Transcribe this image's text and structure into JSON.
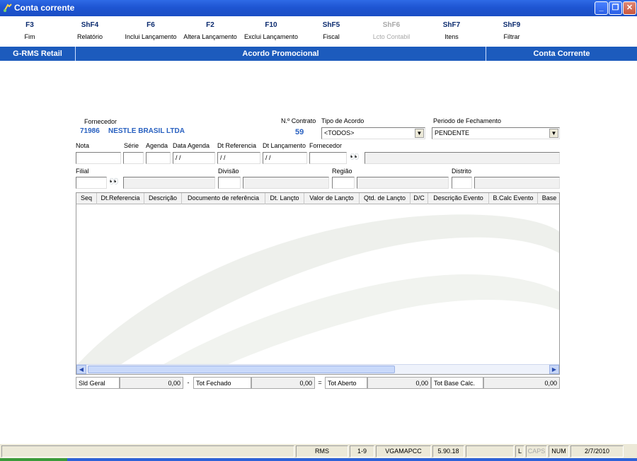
{
  "window": {
    "title": "Conta corrente"
  },
  "toolbar": [
    {
      "key": "F3",
      "label": "Fim",
      "enabled": true
    },
    {
      "key": "ShF4",
      "label": "Relatório",
      "enabled": true
    },
    {
      "key": "F6",
      "label": "Inclui Lançamento",
      "enabled": true
    },
    {
      "key": "F2",
      "label": "Altera Lançamento",
      "enabled": true
    },
    {
      "key": "F10",
      "label": "Exclui Lançamento",
      "enabled": true
    },
    {
      "key": "ShF5",
      "label": "Fiscal",
      "enabled": true
    },
    {
      "key": "ShF6",
      "label": "Lcto Contabil",
      "enabled": false
    },
    {
      "key": "ShF7",
      "label": "Itens",
      "enabled": true
    },
    {
      "key": "ShF9",
      "label": "Filtrar",
      "enabled": true
    }
  ],
  "band": {
    "left": "G-RMS Retail",
    "center": "Acordo Promocional",
    "right": "Conta Corrente",
    "color": "#1c5bbd"
  },
  "form": {
    "fornecedor_label": "Fornecedor",
    "fornecedor_code": "71986",
    "fornecedor_name": "NESTLE BRASIL LTDA",
    "contrato_label": "N.º Contrato",
    "contrato_value": "59",
    "tipo_acordo_label": "Tipo de Acordo",
    "tipo_acordo_value": "<TODOS>",
    "periodo_label": "Periodo de Fechamento",
    "periodo_value": "PENDENTE",
    "nota_label": "Nota",
    "serie_label": "Série",
    "agenda_label": "Agenda",
    "data_agenda_label": "Data Agenda",
    "data_agenda_value": "/ /",
    "dt_referencia_label": "Dt Referencia",
    "dt_referencia_value": "/ /",
    "dt_lancamento_label": "Dt Lançamento",
    "dt_lancamento_value": "/ /",
    "fornecedor2_label": "Fornecedor",
    "filial_label": "Filial",
    "divisao_label": "Divisão",
    "regiao_label": "Região",
    "distrito_label": "Distrito"
  },
  "grid": {
    "columns": [
      "Seq",
      "Dt.Referencia",
      "Descrição",
      "Documento de referência",
      "Dt. Lançto",
      "Valor de Lançto",
      "Qtd. de Lançto",
      "D/C",
      "Descrição Evento",
      "B.Calc Evento",
      "Base"
    ],
    "rows": []
  },
  "totals": {
    "sld_geral_label": "Sld Geral",
    "sld_geral_value": "0,00",
    "minus": "-",
    "tot_fechado_label": "Tot Fechado",
    "tot_fechado_value": "0,00",
    "equals": "=",
    "tot_aberto_label": "Tot Aberto",
    "tot_aberto_value": "0,00",
    "tot_base_label": "Tot Base Calc.",
    "tot_base_value": "0,00"
  },
  "statusbar": {
    "app": "RMS",
    "page": "1-9",
    "program": "VGAMAPCC",
    "version": "5.90.18",
    "l": "L",
    "caps": "CAPS",
    "num": "NUM",
    "date": "2/7/2010"
  }
}
